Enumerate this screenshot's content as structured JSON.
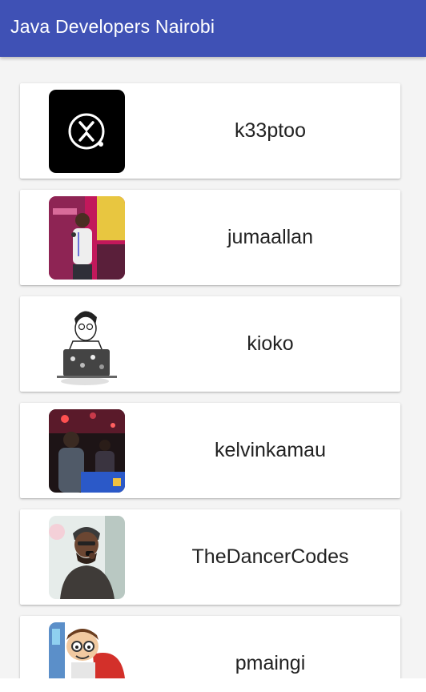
{
  "app": {
    "title": "Java Developers Nairobi",
    "primary_color": "#3f51b5"
  },
  "developers": [
    {
      "username": "k33ptoo",
      "avatar_icon": "kx-logo-avatar"
    },
    {
      "username": "jumaallan",
      "avatar_icon": "speaker-photo-avatar"
    },
    {
      "username": "kioko",
      "avatar_icon": "sketch-laptop-avatar"
    },
    {
      "username": "kelvinkamau",
      "avatar_icon": "event-photo-avatar"
    },
    {
      "username": "TheDancerCodes",
      "avatar_icon": "microphone-photo-avatar"
    },
    {
      "username": "pmaingi",
      "avatar_icon": "cartoon-avatar"
    }
  ]
}
